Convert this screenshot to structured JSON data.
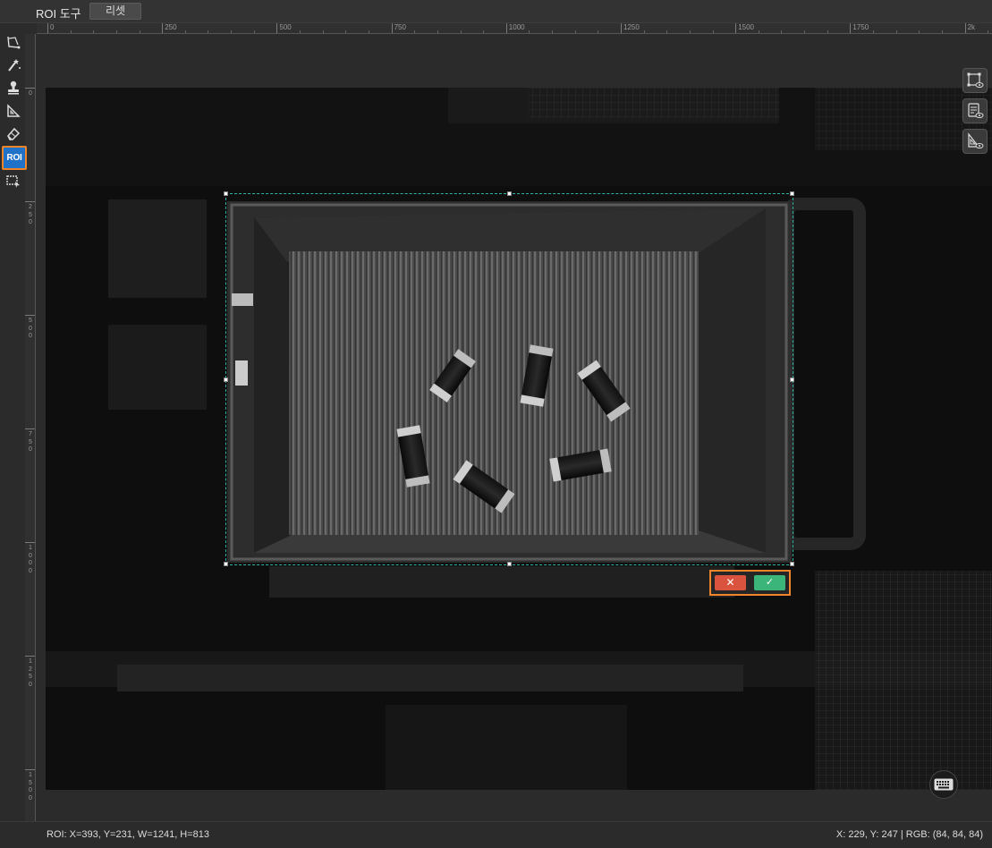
{
  "window": {
    "title": "ROI 도구",
    "reset_label": "리셋"
  },
  "ruler_top": {
    "labels": [
      "0",
      "250",
      "500",
      "750",
      "1000",
      "1250",
      "1500",
      "1750",
      "2k"
    ]
  },
  "ruler_left": {
    "labels": [
      "0",
      "250",
      "500",
      "750",
      "1000",
      "1250",
      "1500"
    ]
  },
  "toolbar": {
    "tools": [
      {
        "name": "polygon-roi-tool-icon"
      },
      {
        "name": "magic-wand-icon"
      },
      {
        "name": "stamp-icon"
      },
      {
        "name": "set-square-icon"
      },
      {
        "name": "eraser-icon"
      },
      {
        "name": "roi-tool-icon",
        "label": "ROI",
        "active": true
      },
      {
        "name": "roi-select-icon"
      }
    ]
  },
  "roi_actions": {
    "cancel_symbol": "✕",
    "confirm_symbol": "✓"
  },
  "right_panel": {
    "buttons": [
      "roi-view-icon",
      "list-view-icon",
      "mask-view-icon"
    ]
  },
  "status": {
    "roi_text": "ROI: X=393, Y=231, W=1241, H=813",
    "pixel_text": "X: 229, Y: 247 | RGB: (84, 84, 84)"
  },
  "colors": {
    "accent_orange": "#f0842b",
    "roi_border": "#2fb3a6",
    "cancel": "#d9533e",
    "confirm": "#3bb579",
    "active_tool": "#1f72c8"
  }
}
